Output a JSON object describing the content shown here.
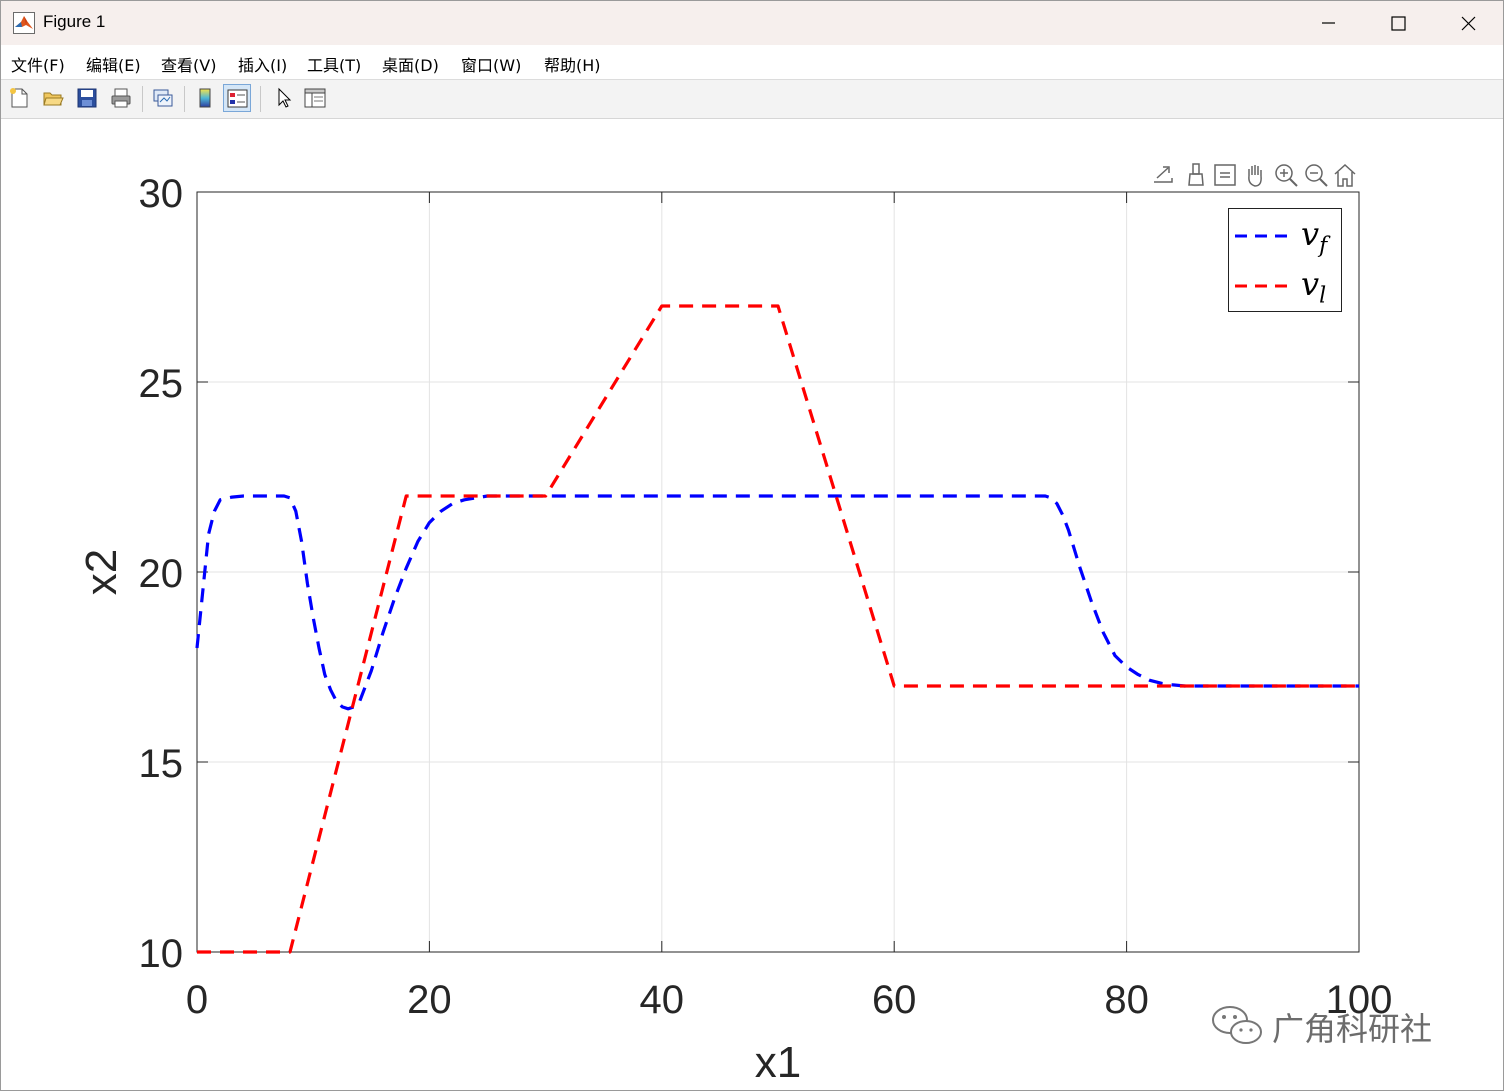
{
  "window": {
    "title": "Figure 1",
    "controls": [
      "minimize",
      "maximize",
      "close"
    ]
  },
  "menu": {
    "items": [
      {
        "label": "文件(F)"
      },
      {
        "label": "编辑(E)"
      },
      {
        "label": "查看(V)"
      },
      {
        "label": "插入(I)"
      },
      {
        "label": "工具(T)"
      },
      {
        "label": "桌面(D)"
      },
      {
        "label": "窗口(W)"
      },
      {
        "label": "帮助(H)"
      }
    ]
  },
  "toolbar": {
    "buttons": [
      "new-figure-icon",
      "open-file-icon",
      "save-icon",
      "print-icon",
      "link-plot-icon",
      "colorbar-icon",
      "legend-icon",
      "pointer-icon",
      "property-inspector-icon"
    ]
  },
  "axes_toolbar": {
    "buttons": [
      "export-icon",
      "brush-icon",
      "data-tips-icon",
      "pan-icon",
      "zoom-in-icon",
      "zoom-out-icon",
      "home-icon"
    ]
  },
  "chart_data": {
    "type": "line",
    "title": "",
    "xlabel": "x1",
    "ylabel": "x2",
    "xlim": [
      0,
      100
    ],
    "ylim": [
      10,
      30
    ],
    "xticks": [
      0,
      20,
      40,
      60,
      80,
      100
    ],
    "yticks": [
      10,
      15,
      20,
      25,
      30
    ],
    "grid": true,
    "legend_position": "top-right",
    "series": [
      {
        "name": "v_f",
        "color": "#0000ff",
        "style": "dashed",
        "x": [
          0,
          0.5,
          1,
          1.5,
          2,
          3,
          4,
          5,
          6,
          7,
          7.5,
          8,
          8.5,
          9,
          9.5,
          10,
          10.5,
          11,
          11.5,
          12,
          12.5,
          13,
          13.5,
          14,
          15,
          16,
          17,
          18,
          19,
          20,
          21,
          22,
          23,
          24,
          25,
          27,
          30,
          35,
          40,
          50,
          60,
          70,
          73,
          73.5,
          74,
          74.5,
          75,
          75.5,
          76,
          77,
          78,
          79,
          80,
          81,
          82,
          83,
          84,
          85,
          87,
          90,
          95,
          100
        ],
        "y": [
          18,
          19.5,
          21.0,
          21.6,
          21.9,
          21.97,
          22.0,
          22.0,
          22.0,
          22.0,
          22.0,
          21.95,
          21.6,
          20.8,
          19.7,
          18.8,
          18.0,
          17.3,
          16.9,
          16.6,
          16.45,
          16.4,
          16.45,
          16.6,
          17.4,
          18.4,
          19.3,
          20.1,
          20.8,
          21.3,
          21.6,
          21.8,
          21.9,
          21.95,
          22.0,
          22.0,
          22.0,
          22.0,
          22.0,
          22.0,
          22.0,
          22.0,
          22.0,
          21.95,
          21.8,
          21.5,
          21.1,
          20.6,
          20.1,
          19.2,
          18.4,
          17.8,
          17.5,
          17.3,
          17.15,
          17.07,
          17.03,
          17.0,
          17.0,
          17.0,
          17.0,
          17.0
        ]
      },
      {
        "name": "v_l",
        "color": "#ff0000",
        "style": "dashed",
        "x": [
          0,
          8,
          18,
          30,
          40,
          50,
          60,
          100
        ],
        "y": [
          10,
          10,
          22,
          22,
          27,
          27,
          17,
          17
        ]
      }
    ]
  },
  "legend": {
    "entries": [
      {
        "label": "v",
        "sub": "f",
        "color": "#0000ff"
      },
      {
        "label": "v",
        "sub": "l",
        "color": "#ff0000"
      }
    ]
  },
  "watermark": {
    "text": "广角科研社"
  }
}
